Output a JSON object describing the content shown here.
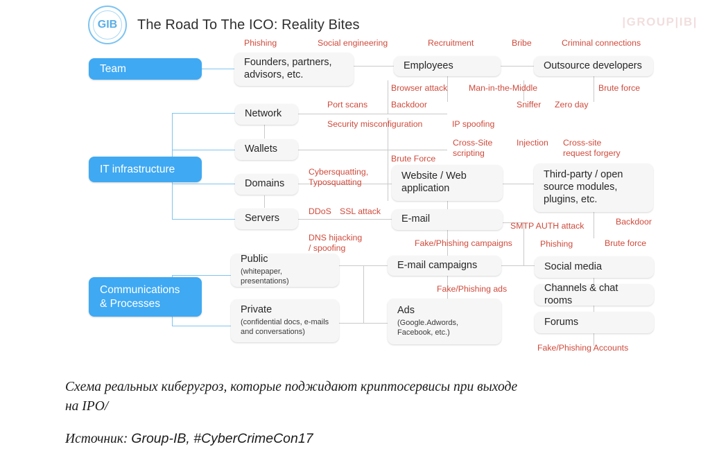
{
  "header": {
    "logo_text": "GIB",
    "logo_icon": "group-ib-logo-icon",
    "title": "The Road To The ICO: Reality Bites",
    "watermark": "|GROUP|IB|"
  },
  "categories": [
    {
      "label": "Team"
    },
    {
      "label": "IT infrastructure"
    },
    {
      "label": "Communications\n& Processes"
    }
  ],
  "nodes": [
    {
      "title": "Founders, partners,\nadvisors, etc.",
      "sub": ""
    },
    {
      "title": "Employees",
      "sub": ""
    },
    {
      "title": "Outsource developers",
      "sub": ""
    },
    {
      "title": "Network",
      "sub": ""
    },
    {
      "title": "Wallets",
      "sub": ""
    },
    {
      "title": "Domains",
      "sub": ""
    },
    {
      "title": "Servers",
      "sub": ""
    },
    {
      "title": "Website / Web\napplication",
      "sub": ""
    },
    {
      "title": "E-mail",
      "sub": ""
    },
    {
      "title": "Third-party / open\nsource modules,\nplugins, etc.",
      "sub": ""
    },
    {
      "title": "Public",
      "sub": "(whitepaper, presentations)"
    },
    {
      "title": "Private",
      "sub": "(confidential docs, e-mails\nand conversations)"
    },
    {
      "title": "E-mail campaigns",
      "sub": ""
    },
    {
      "title": "Ads",
      "sub": "(Google.Adwords,\nFacebook, etc.)"
    },
    {
      "title": "Social media",
      "sub": ""
    },
    {
      "title": "Channels & chat rooms",
      "sub": ""
    },
    {
      "title": "Forums",
      "sub": ""
    }
  ],
  "threats": [
    {
      "label": "Phishing"
    },
    {
      "label": "Social engineering"
    },
    {
      "label": "Recruitment"
    },
    {
      "label": "Bribe"
    },
    {
      "label": "Criminal connections"
    },
    {
      "label": "Browser attack"
    },
    {
      "label": "Man-in-the-Middle"
    },
    {
      "label": "Brute force"
    },
    {
      "label": "Port scans"
    },
    {
      "label": "Backdoor"
    },
    {
      "label": "Sniffer"
    },
    {
      "label": "Zero day"
    },
    {
      "label": "Security misconfiguration"
    },
    {
      "label": "IP spoofing"
    },
    {
      "label": "Brute Force"
    },
    {
      "label": "Cross-Site\nscripting"
    },
    {
      "label": "Injection"
    },
    {
      "label": "Cross-site\nrequest forgery"
    },
    {
      "label": "Cybersquatting,\nTyposquatting"
    },
    {
      "label": "DDoS"
    },
    {
      "label": "SSL attack"
    },
    {
      "label": "DNS hijacking\n/ spoofing"
    },
    {
      "label": "SMTP AUTH attack"
    },
    {
      "label": "Backdoor"
    },
    {
      "label": "Fake/Phishing campaigns"
    },
    {
      "label": "Phishing"
    },
    {
      "label": "Brute force"
    },
    {
      "label": "Fake/Phishing ads"
    },
    {
      "label": "Fake/Phishing Accounts"
    }
  ],
  "caption": {
    "line1": "Схема реальных киберугроз, которые поджидают криптосервисы при выходе\nна IPO/",
    "source_label": "Источник",
    "source_sep": ": ",
    "source_value": "Group-IB, #CyberCrimeCon17"
  },
  "colors": {
    "accent_blue": "#3fa9f3",
    "threat_red": "#cf4a3b",
    "node_bg": "#f6f6f6",
    "connector_gray": "#c9c9c9",
    "connector_blue": "#7fc4ef"
  }
}
